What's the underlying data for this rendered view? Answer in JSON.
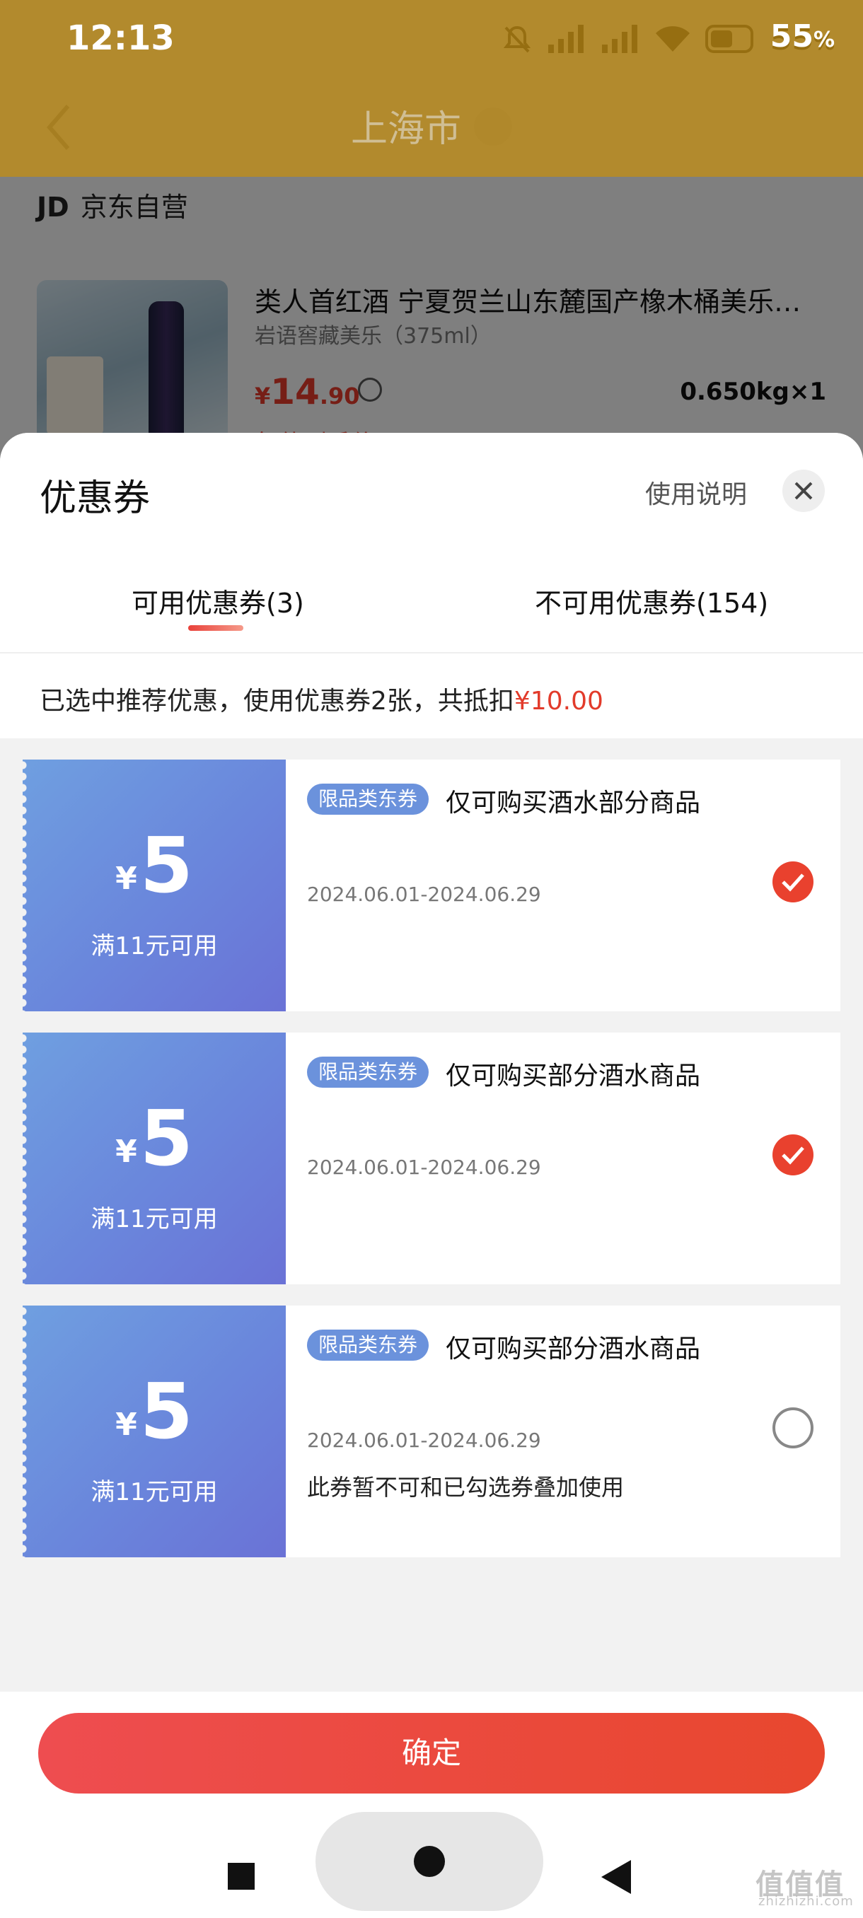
{
  "status_bar": {
    "time": "12:13",
    "battery": "55",
    "battery_unit": "%",
    "icons": [
      "mute-icon",
      "signal-icon",
      "signal-icon",
      "wifi-icon",
      "battery-icon"
    ]
  },
  "nav": {
    "city": "上海市",
    "back_icon": "chevron-left-icon",
    "location_icon": "location-pin-icon",
    "tint_color": "#bf8c14"
  },
  "shop": {
    "logo": "JD",
    "name": "京东自营"
  },
  "product": {
    "title": "类人首红酒 宁夏贺兰山东麓国产橡木桶美乐…",
    "subtitle": "岩语窖藏美乐（375ml）",
    "price_symbol": "¥",
    "price_int": "14",
    "price_dec": ".90",
    "quantity": "0.650kg×1",
    "extra": "每件到手价"
  },
  "sheet": {
    "title": "优惠券",
    "help_label": "使用说明",
    "tabs": [
      {
        "label": "可用优惠券(3)",
        "active": true
      },
      {
        "label": "不可用优惠券(154)",
        "active": false
      }
    ],
    "summary_prefix": "已选中推荐优惠，使用优惠券2张，共抵扣",
    "summary_amount": "¥10.00"
  },
  "coupons": [
    {
      "symbol": "¥",
      "amount": "5",
      "condition": "满11元可用",
      "tag": "限品类东券",
      "desc": "仅可购买酒水部分商品",
      "date": "2024.06.01-2024.06.29",
      "note": "",
      "selected": true
    },
    {
      "symbol": "¥",
      "amount": "5",
      "condition": "满11元可用",
      "tag": "限品类东券",
      "desc": "仅可购买部分酒水商品",
      "date": "2024.06.01-2024.06.29",
      "note": "",
      "selected": true
    },
    {
      "symbol": "¥",
      "amount": "5",
      "condition": "满11元可用",
      "tag": "限品类东券",
      "desc": "仅可购买部分酒水商品",
      "date": "2024.06.01-2024.06.29",
      "note": "此券暂不可和已勾选券叠加使用",
      "selected": false
    }
  ],
  "footer": {
    "confirm_label": "确定"
  },
  "watermark": {
    "text": "值值值",
    "sub": "zhizhizhi.com"
  },
  "colors": {
    "accent_red": "#e23b2b",
    "coupon_blue": "#6a86dc",
    "check_red": "#e9412e"
  }
}
